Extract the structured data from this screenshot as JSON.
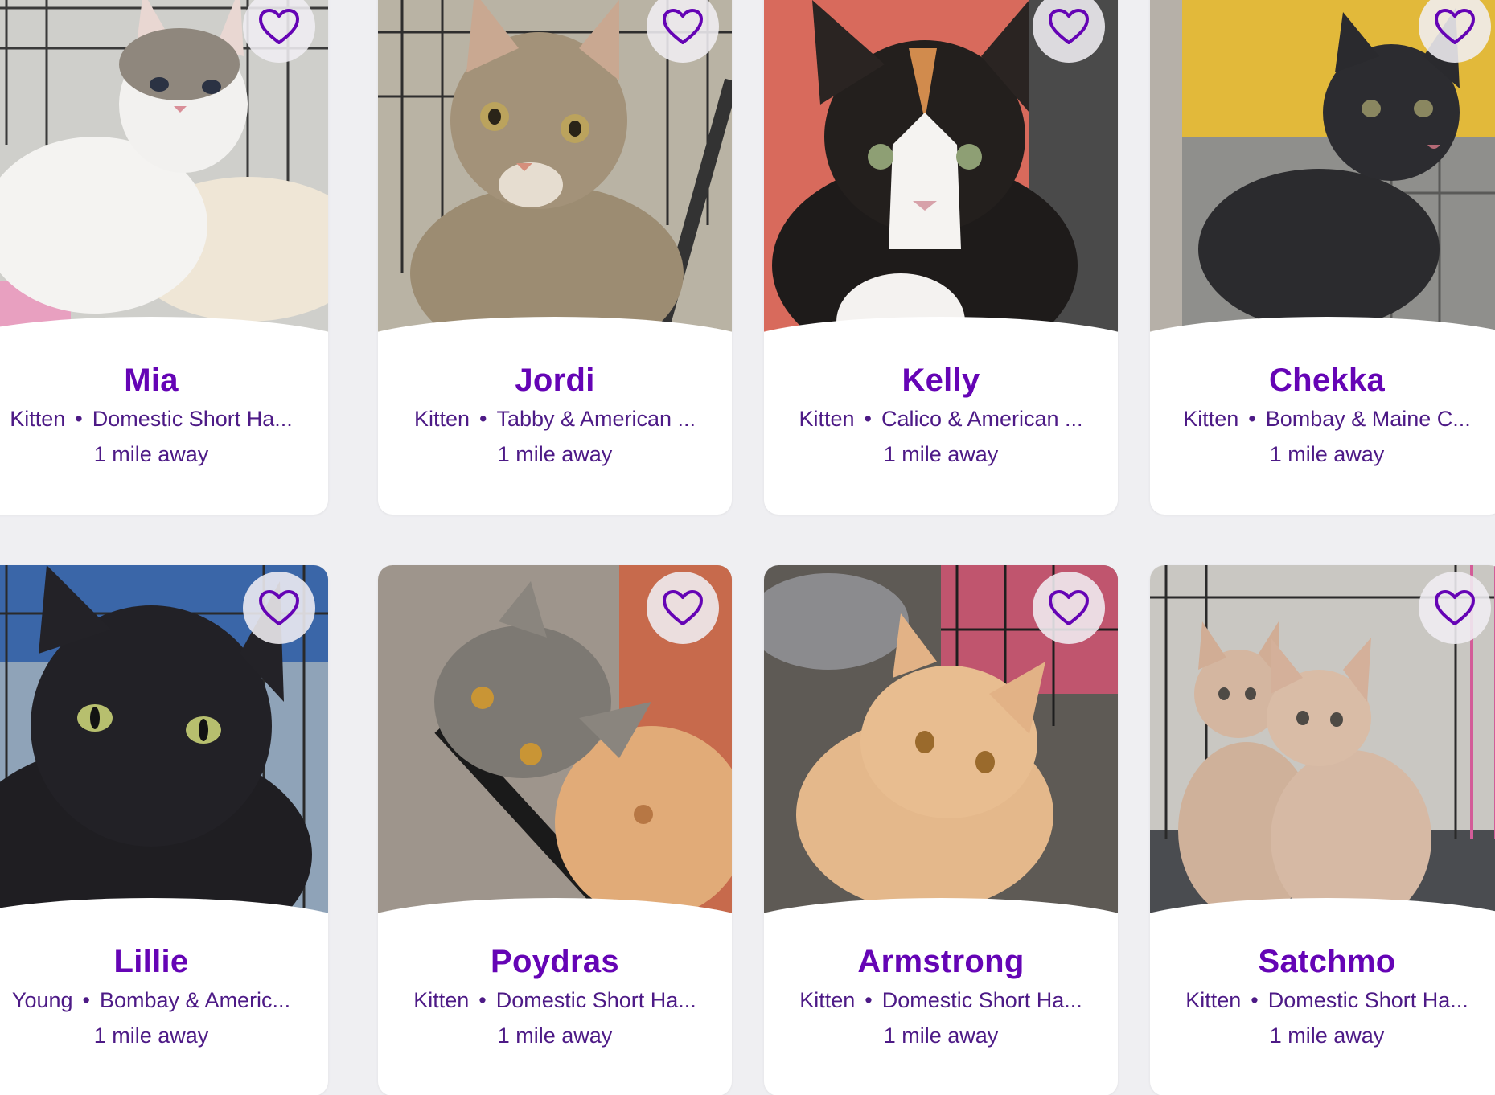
{
  "theme": {
    "accent": "#6504b5",
    "text": "#4d1a86",
    "background": "#efeff2"
  },
  "pets": [
    {
      "name": "Mia",
      "age": "Kitten",
      "breed": "Domestic Short Ha...",
      "distance": "1 mile away",
      "favorite_icon": "heart-outline-icon"
    },
    {
      "name": "Jordi",
      "age": "Kitten",
      "breed": "Tabby & American ...",
      "distance": "1 mile away",
      "favorite_icon": "heart-outline-icon"
    },
    {
      "name": "Kelly",
      "age": "Kitten",
      "breed": "Calico & American ...",
      "distance": "1 mile away",
      "favorite_icon": "heart-outline-icon"
    },
    {
      "name": "Chekka",
      "age": "Kitten",
      "breed": "Bombay & Maine C...",
      "distance": "1 mile away",
      "favorite_icon": "heart-outline-icon"
    },
    {
      "name": "Lillie",
      "age": "Young",
      "breed": "Bombay & Americ...",
      "distance": "1 mile away",
      "favorite_icon": "heart-outline-icon"
    },
    {
      "name": "Poydras",
      "age": "Kitten",
      "breed": "Domestic Short Ha...",
      "distance": "1 mile away",
      "favorite_icon": "heart-outline-icon"
    },
    {
      "name": "Armstrong",
      "age": "Kitten",
      "breed": "Domestic Short Ha...",
      "distance": "1 mile away",
      "favorite_icon": "heart-outline-icon"
    },
    {
      "name": "Satchmo",
      "age": "Kitten",
      "breed": "Domestic Short Ha...",
      "distance": "1 mile away",
      "favorite_icon": "heart-outline-icon"
    }
  ],
  "separator": "•"
}
